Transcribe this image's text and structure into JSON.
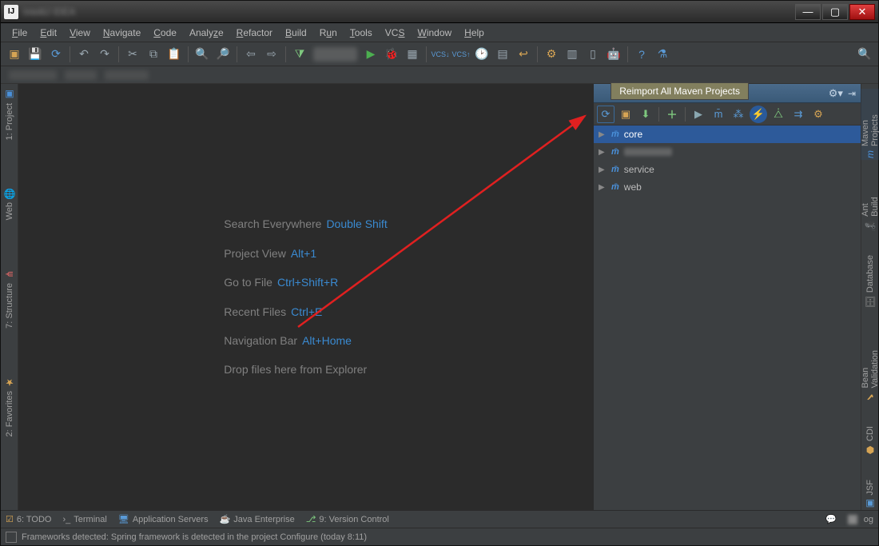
{
  "titlebar": {
    "app_icon": "IJ",
    "title": "IntelliJ IDEA"
  },
  "menu": [
    "File",
    "Edit",
    "View",
    "Navigate",
    "Code",
    "Analyze",
    "Refactor",
    "Build",
    "Run",
    "Tools",
    "VCS",
    "Window",
    "Help"
  ],
  "welcome": {
    "l1": "Search Everywhere",
    "s1": "Double Shift",
    "l2": "Project View",
    "s2": "Alt+1",
    "l3": "Go to File",
    "s3": "Ctrl+Shift+R",
    "l4": "Recent Files",
    "s4": "Ctrl+E",
    "l5": "Navigation Bar",
    "s5": "Alt+Home",
    "l6": "Drop files here from Explorer"
  },
  "left_tabs": {
    "project": "1: Project",
    "web": "Web",
    "structure": "7: Structure",
    "favorites": "2: Favorites"
  },
  "right_tabs": {
    "maven": "Maven Projects",
    "ant": "Ant Build",
    "database": "Database",
    "bean": "Bean Validation",
    "cdi": "CDI",
    "jsf": "JSF"
  },
  "maven": {
    "tooltip": "Reimport All Maven Projects",
    "items": [
      "core",
      "",
      "service",
      "web"
    ]
  },
  "bottom_tabs": {
    "todo": "6: TODO",
    "terminal": "Terminal",
    "appservers": "Application Servers",
    "javaee": "Java Enterprise",
    "vcs": "9: Version Control",
    "og": "og"
  },
  "status": {
    "text": "Frameworks detected: Spring framework is detected in the project Configure (today 8:11)"
  }
}
